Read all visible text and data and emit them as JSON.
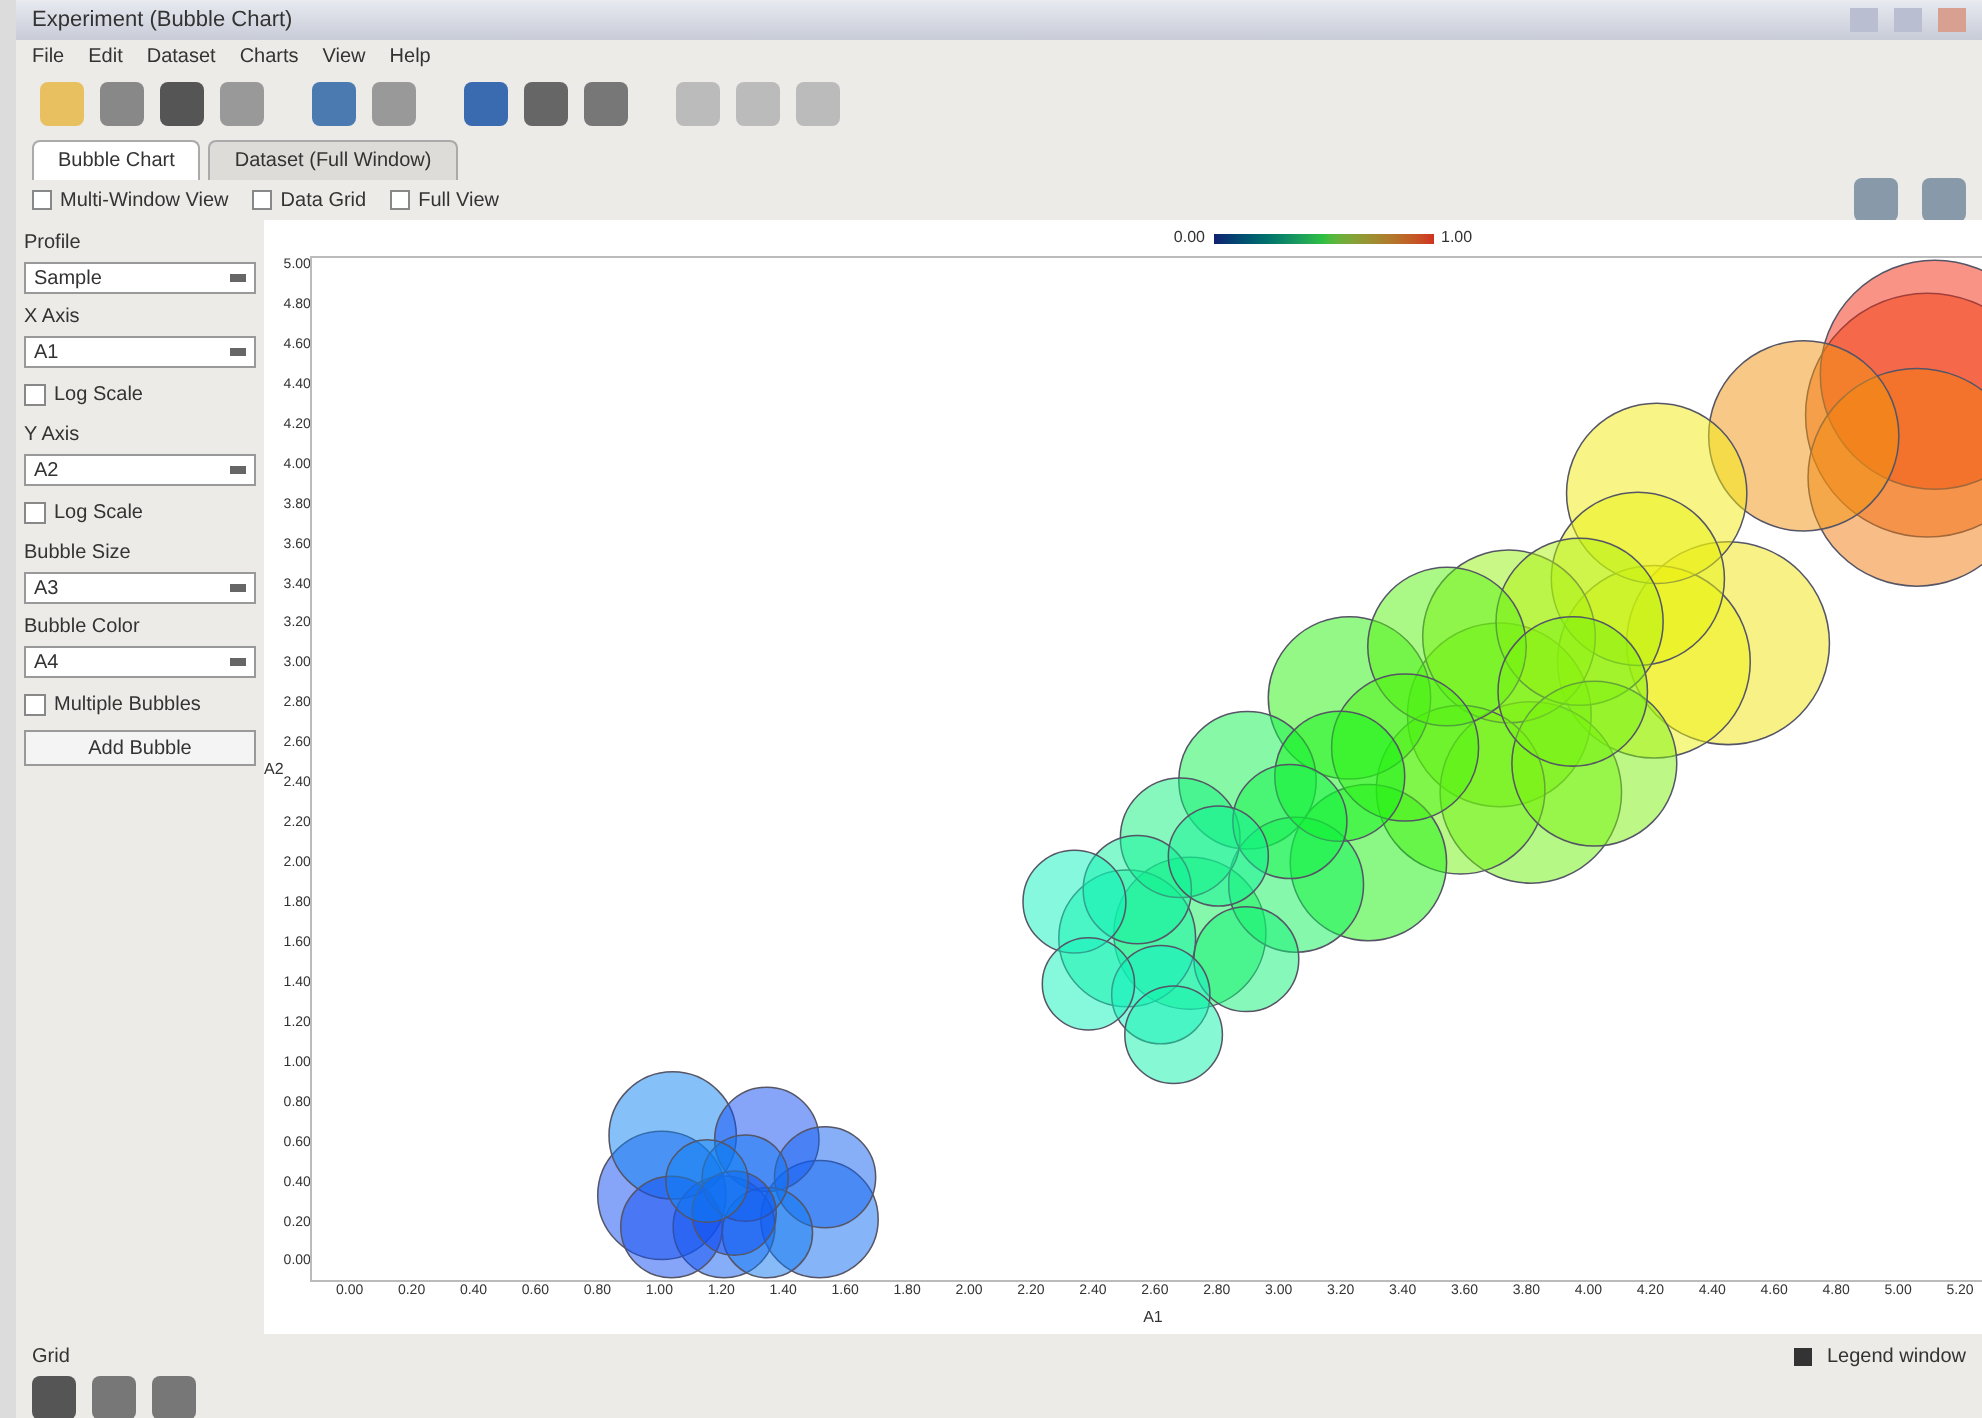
{
  "window": {
    "title": "Experiment (Bubble Chart)"
  },
  "menu": [
    "File",
    "Edit",
    "Dataset",
    "Charts",
    "View",
    "Help"
  ],
  "tabs": [
    {
      "label": "Bubble Chart",
      "selected": true
    },
    {
      "label": "Dataset (Full Window)",
      "selected": false
    }
  ],
  "view_options": [
    {
      "label": "Multi-Window View",
      "checked": false
    },
    {
      "label": "Data Grid",
      "checked": false
    },
    {
      "label": "Full View",
      "checked": false
    }
  ],
  "controls": [
    {
      "kind": "select",
      "label": "Profile",
      "value": "Sample"
    },
    {
      "kind": "select",
      "label": "X Axis",
      "value": "A1"
    },
    {
      "kind": "check",
      "label": "Log Scale",
      "checked": false
    },
    {
      "kind": "select",
      "label": "Y Axis",
      "value": "A2"
    },
    {
      "kind": "check",
      "label": "Log Scale",
      "checked": false
    },
    {
      "kind": "select",
      "label": "Bubble Size",
      "value": "A3"
    },
    {
      "kind": "select",
      "label": "Bubble Color",
      "value": "A4"
    },
    {
      "kind": "check",
      "label": "Multiple Bubbles",
      "checked": false
    },
    {
      "kind": "button",
      "label": "Add Bubble"
    }
  ],
  "chart": {
    "legend_min": "0.00",
    "legend_max": "1.00",
    "xlabel": "A1",
    "ylabel": "A2",
    "xticks": [
      "0.00",
      "0.20",
      "0.40",
      "0.60",
      "0.80",
      "1.00",
      "1.20",
      "1.40",
      "1.60",
      "1.80",
      "2.00",
      "2.20",
      "2.40",
      "2.60",
      "2.80",
      "3.00",
      "3.20",
      "3.40",
      "3.60",
      "3.80",
      "4.00",
      "4.20",
      "4.40",
      "4.60",
      "4.80",
      "5.00",
      "5.20"
    ],
    "yticks": [
      "5.00",
      "4.80",
      "4.60",
      "4.40",
      "4.20",
      "4.00",
      "3.80",
      "3.60",
      "3.40",
      "3.20",
      "3.00",
      "2.80",
      "2.60",
      "2.40",
      "2.20",
      "2.00",
      "1.80",
      "1.60",
      "1.40",
      "1.20",
      "1.00",
      "0.80",
      "0.60",
      "0.40",
      "0.20",
      "0.00"
    ]
  },
  "status_left": "Grid",
  "status_right": "Legend window"
}
